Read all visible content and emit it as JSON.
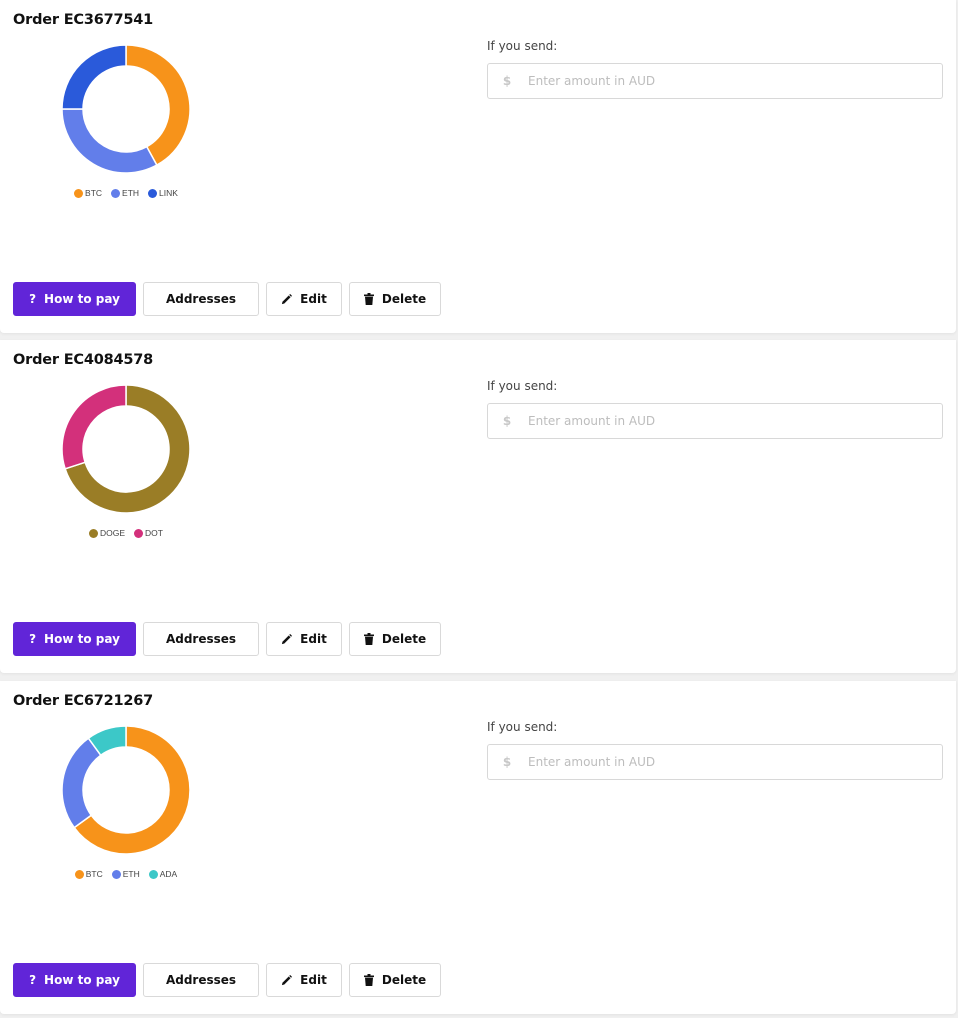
{
  "orders": [
    {
      "title": "Order EC3677541",
      "send_label": "If you send:",
      "amount": {
        "currency_symbol": "$",
        "value": "",
        "placeholder": "Enter amount in AUD"
      },
      "buttons": {
        "how_to_pay": "How to pay",
        "addresses": "Addresses",
        "edit": "Edit",
        "delete": "Delete"
      },
      "chart_data": {
        "type": "pie",
        "variant": "donut",
        "title": "",
        "categories": [
          "BTC",
          "ETH",
          "LINK"
        ],
        "values": [
          42,
          33,
          25
        ],
        "colors": [
          "#f7931a",
          "#627eea",
          "#2a5ada"
        ],
        "legend": "bottom"
      }
    },
    {
      "title": "Order EC4084578",
      "send_label": "If you send:",
      "amount": {
        "currency_symbol": "$",
        "value": "",
        "placeholder": "Enter amount in AUD"
      },
      "buttons": {
        "how_to_pay": "How to pay",
        "addresses": "Addresses",
        "edit": "Edit",
        "delete": "Delete"
      },
      "chart_data": {
        "type": "pie",
        "variant": "donut",
        "title": "",
        "categories": [
          "DOGE",
          "DOT"
        ],
        "values": [
          70,
          30
        ],
        "colors": [
          "#9a7d26",
          "#d3307b"
        ],
        "legend": "bottom"
      }
    },
    {
      "title": "Order EC6721267",
      "send_label": "If you send:",
      "amount": {
        "currency_symbol": "$",
        "value": "",
        "placeholder": "Enter amount in AUD"
      },
      "buttons": {
        "how_to_pay": "How to pay",
        "addresses": "Addresses",
        "edit": "Edit",
        "delete": "Delete"
      },
      "chart_data": {
        "type": "pie",
        "variant": "donut",
        "title": "",
        "categories": [
          "BTC",
          "ETH",
          "ADA"
        ],
        "values": [
          65,
          25,
          10
        ],
        "colors": [
          "#f7931a",
          "#627eea",
          "#3cc8c8"
        ],
        "legend": "bottom"
      }
    }
  ],
  "icons": {
    "how_to_pay": "question-mark-icon",
    "edit": "pencil-icon",
    "delete": "trash-icon",
    "currency": "dollar-icon"
  },
  "theme": {
    "primary": "#6125d8",
    "page_bg": "#f0f0f0"
  }
}
